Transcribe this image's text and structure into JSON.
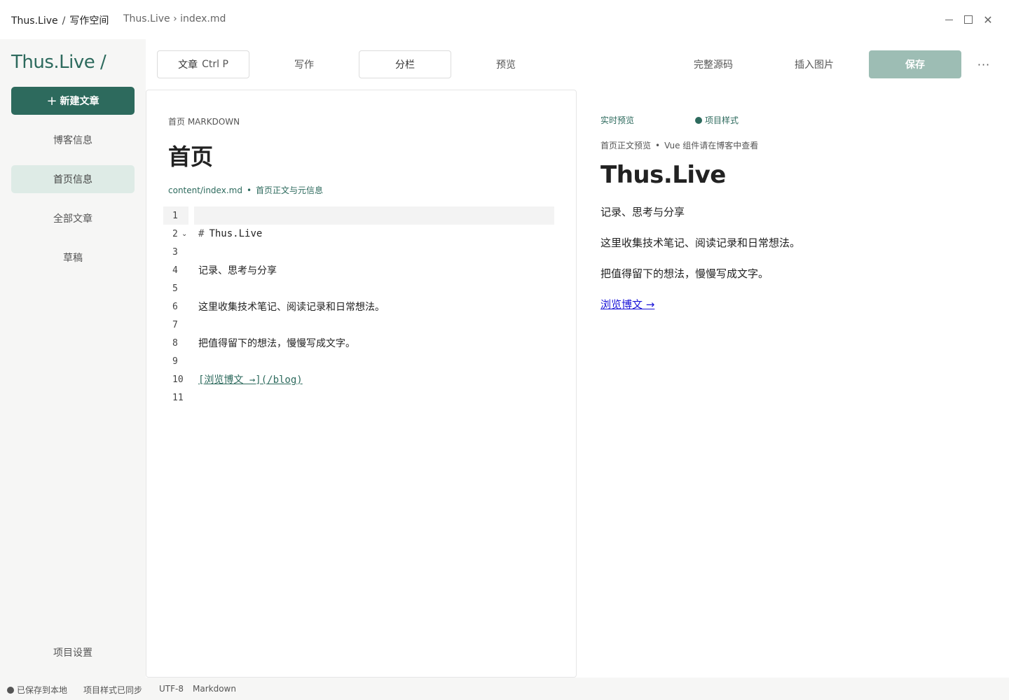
{
  "titlebar": {
    "app_name": "Thus.Live",
    "separator": "/",
    "workspace": "写作空间",
    "path": "Thus.Live › index.md",
    "close_glyph": "✕"
  },
  "sidebar": {
    "brand": "Thus.Live /",
    "new_button": {
      "plus": "+",
      "label": "新建文章"
    },
    "items": [
      {
        "label": "博客信息",
        "active": false
      },
      {
        "label": "首页信息",
        "active": true
      },
      {
        "label": "全部文章",
        "active": false
      },
      {
        "label": "草稿",
        "active": false
      }
    ],
    "settings_label": "项目设置"
  },
  "toolbar": {
    "tabs": [
      {
        "label": "文章",
        "shortcut": "Ctrl P"
      },
      {
        "label": "写作"
      },
      {
        "label": "分栏"
      },
      {
        "label": "预览"
      }
    ],
    "source_label": "完整源码",
    "insert_image_label": "插入图片",
    "save_label": "保存",
    "more_glyph": "···"
  },
  "editor": {
    "kicker": "首页 MARKDOWN",
    "title": "首页",
    "meta_path": "content/index.md",
    "meta_dot": "•",
    "meta_desc": "首页正文与元信息",
    "lines": [
      {
        "num": "1",
        "text": ""
      },
      {
        "num": "2",
        "hash": "#",
        "text": "Thus.Live"
      },
      {
        "num": "3",
        "text": ""
      },
      {
        "num": "4",
        "text": "记录、思考与分享"
      },
      {
        "num": "5",
        "text": ""
      },
      {
        "num": "6",
        "text": "这里收集技术笔记、阅读记录和日常想法。"
      },
      {
        "num": "7",
        "text": ""
      },
      {
        "num": "8",
        "text": "把值得留下的想法，慢慢写成文字。"
      },
      {
        "num": "9",
        "text": ""
      },
      {
        "num": "10",
        "text": "[浏览博文 →](/blog)"
      },
      {
        "num": "11",
        "text": ""
      }
    ]
  },
  "preview": {
    "live_label": "实时预览",
    "style_label": "项目样式",
    "subtitle_left": "首页正文预览",
    "subtitle_dot": "•",
    "subtitle_right": "Vue 组件请在博客中查看",
    "h1": "Thus.Live",
    "p1": "记录、思考与分享",
    "p2": "这里收集技术笔记、阅读记录和日常想法。",
    "p3": "把值得留下的想法，慢慢写成文字。",
    "link": "浏览博文 →"
  },
  "statusbar": {
    "saved": "已保存到本地",
    "style_synced": "项目样式已同步",
    "encoding": "UTF-8",
    "language": "Markdown"
  },
  "colors": {
    "accent": "#2d6a5d",
    "save_disabled": "#9dbdb4",
    "active_nav": "#deebe6",
    "sidebar_bg": "#f6f6f5",
    "link": "#1a14d8"
  }
}
